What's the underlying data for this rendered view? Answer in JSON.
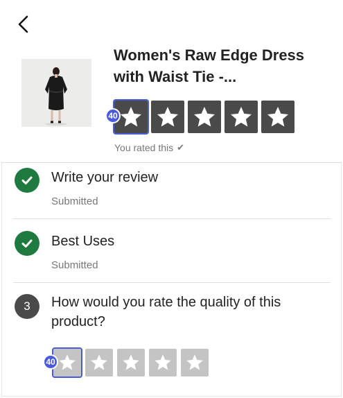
{
  "product": {
    "title": "Women's Raw Edge Dress with Waist Tie -...",
    "image_alt": "dress-photo"
  },
  "rating": {
    "stars": 5,
    "badge": "40",
    "rated_label": "You rated this",
    "rated_check": "✔"
  },
  "steps": [
    {
      "icon": "check",
      "title": "Write your review",
      "status": "Submitted"
    },
    {
      "icon": "check",
      "title": "Best Uses",
      "status": "Submitted"
    },
    {
      "icon": "number",
      "number": "3",
      "title": "How would you rate the quality of this product?"
    }
  ],
  "quality_rating": {
    "stars": 5,
    "badge": "40"
  },
  "colors": {
    "star_filled_bg": "#4a4a4a",
    "star_empty_bg": "#c4c4c4",
    "done_green": "#1e7a3e",
    "focus_blue": "#4a5ae0"
  }
}
